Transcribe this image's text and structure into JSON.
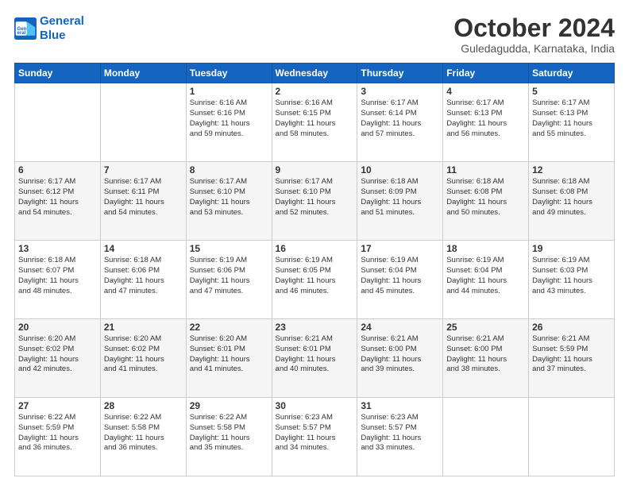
{
  "logo": {
    "line1": "General",
    "line2": "Blue"
  },
  "title": "October 2024",
  "subtitle": "Guledagudda, Karnataka, India",
  "days_header": [
    "Sunday",
    "Monday",
    "Tuesday",
    "Wednesday",
    "Thursday",
    "Friday",
    "Saturday"
  ],
  "weeks": [
    [
      {
        "day": "",
        "content": ""
      },
      {
        "day": "",
        "content": ""
      },
      {
        "day": "1",
        "content": "Sunrise: 6:16 AM\nSunset: 6:16 PM\nDaylight: 11 hours\nand 59 minutes."
      },
      {
        "day": "2",
        "content": "Sunrise: 6:16 AM\nSunset: 6:15 PM\nDaylight: 11 hours\nand 58 minutes."
      },
      {
        "day": "3",
        "content": "Sunrise: 6:17 AM\nSunset: 6:14 PM\nDaylight: 11 hours\nand 57 minutes."
      },
      {
        "day": "4",
        "content": "Sunrise: 6:17 AM\nSunset: 6:13 PM\nDaylight: 11 hours\nand 56 minutes."
      },
      {
        "day": "5",
        "content": "Sunrise: 6:17 AM\nSunset: 6:13 PM\nDaylight: 11 hours\nand 55 minutes."
      }
    ],
    [
      {
        "day": "6",
        "content": "Sunrise: 6:17 AM\nSunset: 6:12 PM\nDaylight: 11 hours\nand 54 minutes."
      },
      {
        "day": "7",
        "content": "Sunrise: 6:17 AM\nSunset: 6:11 PM\nDaylight: 11 hours\nand 54 minutes."
      },
      {
        "day": "8",
        "content": "Sunrise: 6:17 AM\nSunset: 6:10 PM\nDaylight: 11 hours\nand 53 minutes."
      },
      {
        "day": "9",
        "content": "Sunrise: 6:17 AM\nSunset: 6:10 PM\nDaylight: 11 hours\nand 52 minutes."
      },
      {
        "day": "10",
        "content": "Sunrise: 6:18 AM\nSunset: 6:09 PM\nDaylight: 11 hours\nand 51 minutes."
      },
      {
        "day": "11",
        "content": "Sunrise: 6:18 AM\nSunset: 6:08 PM\nDaylight: 11 hours\nand 50 minutes."
      },
      {
        "day": "12",
        "content": "Sunrise: 6:18 AM\nSunset: 6:08 PM\nDaylight: 11 hours\nand 49 minutes."
      }
    ],
    [
      {
        "day": "13",
        "content": "Sunrise: 6:18 AM\nSunset: 6:07 PM\nDaylight: 11 hours\nand 48 minutes."
      },
      {
        "day": "14",
        "content": "Sunrise: 6:18 AM\nSunset: 6:06 PM\nDaylight: 11 hours\nand 47 minutes."
      },
      {
        "day": "15",
        "content": "Sunrise: 6:19 AM\nSunset: 6:06 PM\nDaylight: 11 hours\nand 47 minutes."
      },
      {
        "day": "16",
        "content": "Sunrise: 6:19 AM\nSunset: 6:05 PM\nDaylight: 11 hours\nand 46 minutes."
      },
      {
        "day": "17",
        "content": "Sunrise: 6:19 AM\nSunset: 6:04 PM\nDaylight: 11 hours\nand 45 minutes."
      },
      {
        "day": "18",
        "content": "Sunrise: 6:19 AM\nSunset: 6:04 PM\nDaylight: 11 hours\nand 44 minutes."
      },
      {
        "day": "19",
        "content": "Sunrise: 6:19 AM\nSunset: 6:03 PM\nDaylight: 11 hours\nand 43 minutes."
      }
    ],
    [
      {
        "day": "20",
        "content": "Sunrise: 6:20 AM\nSunset: 6:02 PM\nDaylight: 11 hours\nand 42 minutes."
      },
      {
        "day": "21",
        "content": "Sunrise: 6:20 AM\nSunset: 6:02 PM\nDaylight: 11 hours\nand 41 minutes."
      },
      {
        "day": "22",
        "content": "Sunrise: 6:20 AM\nSunset: 6:01 PM\nDaylight: 11 hours\nand 41 minutes."
      },
      {
        "day": "23",
        "content": "Sunrise: 6:21 AM\nSunset: 6:01 PM\nDaylight: 11 hours\nand 40 minutes."
      },
      {
        "day": "24",
        "content": "Sunrise: 6:21 AM\nSunset: 6:00 PM\nDaylight: 11 hours\nand 39 minutes."
      },
      {
        "day": "25",
        "content": "Sunrise: 6:21 AM\nSunset: 6:00 PM\nDaylight: 11 hours\nand 38 minutes."
      },
      {
        "day": "26",
        "content": "Sunrise: 6:21 AM\nSunset: 5:59 PM\nDaylight: 11 hours\nand 37 minutes."
      }
    ],
    [
      {
        "day": "27",
        "content": "Sunrise: 6:22 AM\nSunset: 5:59 PM\nDaylight: 11 hours\nand 36 minutes."
      },
      {
        "day": "28",
        "content": "Sunrise: 6:22 AM\nSunset: 5:58 PM\nDaylight: 11 hours\nand 36 minutes."
      },
      {
        "day": "29",
        "content": "Sunrise: 6:22 AM\nSunset: 5:58 PM\nDaylight: 11 hours\nand 35 minutes."
      },
      {
        "day": "30",
        "content": "Sunrise: 6:23 AM\nSunset: 5:57 PM\nDaylight: 11 hours\nand 34 minutes."
      },
      {
        "day": "31",
        "content": "Sunrise: 6:23 AM\nSunset: 5:57 PM\nDaylight: 11 hours\nand 33 minutes."
      },
      {
        "day": "",
        "content": ""
      },
      {
        "day": "",
        "content": ""
      }
    ]
  ]
}
